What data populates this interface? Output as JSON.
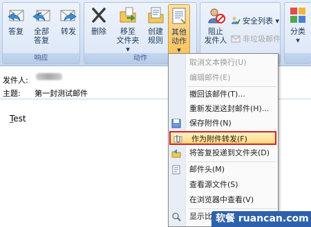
{
  "ribbon": {
    "groups": {
      "respond": "响应",
      "actions": "动作"
    },
    "buttons": {
      "reply": "答复",
      "reply_all": [
        "全部",
        "答复"
      ],
      "forward": "转发",
      "delete": "删除",
      "move_folder": [
        "移至",
        "文件夹 ▾"
      ],
      "create_rule": [
        "创建",
        "规则"
      ],
      "other_actions": [
        "其他",
        "动作 ▾"
      ],
      "block_sender": [
        "阻止",
        "发件人"
      ],
      "safe_list": "安全列表 ▾",
      "not_junk": "非垃圾邮件",
      "categorize": [
        "分类",
        "▾"
      ]
    }
  },
  "header": {
    "from_label": "发件人:",
    "subject_label": "主题:",
    "subject_value": "第一封测试邮件"
  },
  "body": {
    "text": "Test"
  },
  "menu": {
    "items": [
      {
        "label": "取消文本换行(U)",
        "disabled": true,
        "icon": ""
      },
      {
        "label": "编辑邮件(E)",
        "disabled": true,
        "icon": ""
      },
      {
        "label": "撤回该邮件(T)...",
        "disabled": false,
        "icon": ""
      },
      {
        "label": "重新发送这封邮件(H)...",
        "disabled": false,
        "icon": ""
      },
      {
        "label": "保存附件(N)",
        "disabled": false,
        "icon": "save-attachment-icon"
      },
      {
        "label": "作为附件转发(F)",
        "disabled": false,
        "icon": "forward-as-attachment-icon",
        "highlighted": true
      },
      {
        "label": "将答复投递到文件夹(D)",
        "disabled": false,
        "icon": "deliver-replies-icon"
      },
      {
        "label": "邮件头(M)",
        "disabled": false,
        "icon": "message-header-icon"
      },
      {
        "label": "查看源文件(S)",
        "disabled": false,
        "icon": ""
      },
      {
        "label": "在浏览器中查看(V)",
        "disabled": false,
        "icon": ""
      },
      {
        "label": "显示比例",
        "disabled": false,
        "icon": "zoom-icon"
      }
    ]
  },
  "watermark": {
    "left": "软餐",
    "right": "ruancan.com"
  },
  "colors": {
    "highlight_border": "#d42020",
    "ribbon_bg": "#d6e3f4",
    "watermark_bg": "#2d61ac"
  }
}
